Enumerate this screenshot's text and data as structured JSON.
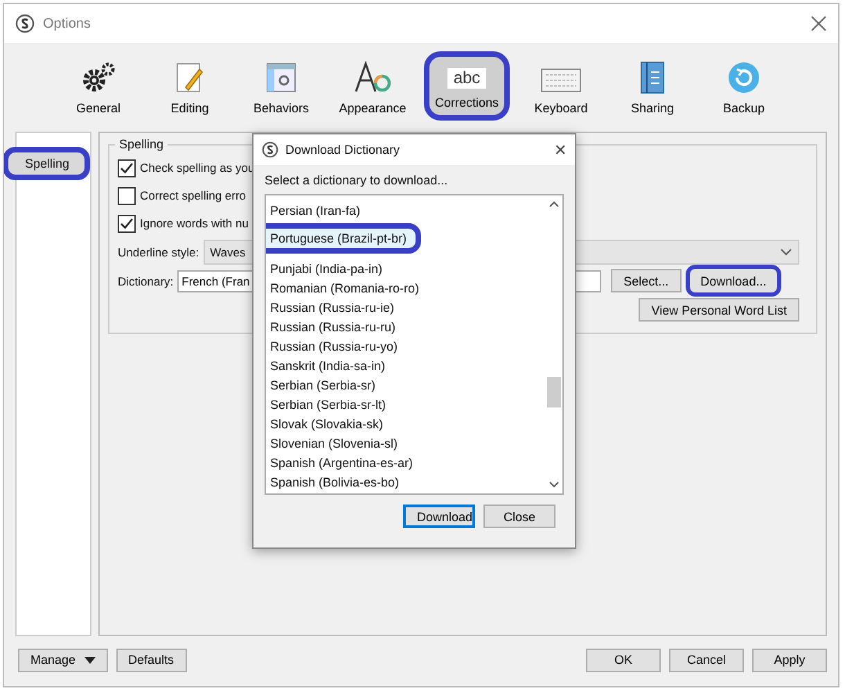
{
  "window": {
    "title": "Options"
  },
  "toolbar": [
    {
      "label": "General",
      "selected": false,
      "highlighted": false
    },
    {
      "label": "Editing",
      "selected": false,
      "highlighted": false
    },
    {
      "label": "Behaviors",
      "selected": false,
      "highlighted": false
    },
    {
      "label": "Appearance",
      "selected": false,
      "highlighted": false
    },
    {
      "label": "Corrections",
      "icon_text": "abc",
      "selected": true,
      "highlighted": true
    },
    {
      "label": "Keyboard",
      "selected": false,
      "highlighted": false
    },
    {
      "label": "Sharing",
      "selected": false,
      "highlighted": false
    },
    {
      "label": "Backup",
      "selected": false,
      "highlighted": false
    }
  ],
  "sidebar": {
    "items": [
      {
        "label": "Spelling",
        "selected": true,
        "highlighted": true
      }
    ]
  },
  "spelling": {
    "title": "Spelling",
    "checkboxes": [
      {
        "label": "Check spelling as you",
        "checked": true
      },
      {
        "label": "Correct spelling erro",
        "checked": false
      },
      {
        "label": "Ignore words with nu",
        "checked": true
      }
    ],
    "underline_label": "Underline style:",
    "underline_value": "Waves",
    "dictionary_label": "Dictionary:",
    "dictionary_value": "French (Fran",
    "buttons": [
      {
        "label": "Select...",
        "highlighted": false
      },
      {
        "label": "Download...",
        "highlighted": true
      }
    ],
    "word_list_button": "View Personal Word List"
  },
  "dialog": {
    "title": "Download Dictionary",
    "close": "✕",
    "prompt": "Select a dictionary to download...",
    "items": [
      {
        "label": "Persian (Iran-fa)",
        "selected": false,
        "highlighted": false
      },
      {
        "label": "Portuguese (Brazil-pt-br)",
        "selected": true,
        "highlighted": true
      },
      {
        "label": "Punjabi (India-pa-in)",
        "selected": false,
        "highlighted": false
      },
      {
        "label": "Romanian (Romania-ro-ro)",
        "selected": false,
        "highlighted": false
      },
      {
        "label": "Russian (Russia-ru-ie)",
        "selected": false,
        "highlighted": false
      },
      {
        "label": "Russian (Russia-ru-ru)",
        "selected": false,
        "highlighted": false
      },
      {
        "label": "Russian (Russia-ru-yo)",
        "selected": false,
        "highlighted": false
      },
      {
        "label": "Sanskrit (India-sa-in)",
        "selected": false,
        "highlighted": false
      },
      {
        "label": "Serbian (Serbia-sr)",
        "selected": false,
        "highlighted": false
      },
      {
        "label": "Serbian (Serbia-sr-lt)",
        "selected": false,
        "highlighted": false
      },
      {
        "label": "Slovak (Slovakia-sk)",
        "selected": false,
        "highlighted": false
      },
      {
        "label": "Slovenian (Slovenia-sl)",
        "selected": false,
        "highlighted": false
      },
      {
        "label": "Spanish (Argentina-es-ar)",
        "selected": false,
        "highlighted": false
      },
      {
        "label": "Spanish (Bolivia-es-bo)",
        "selected": false,
        "highlighted": false
      }
    ],
    "buttons": [
      {
        "label": "Download",
        "default": true
      },
      {
        "label": "Close",
        "default": false
      }
    ]
  },
  "footer": {
    "manage": "Manage",
    "defaults": "Defaults",
    "buttons": [
      "OK",
      "Cancel",
      "Apply"
    ]
  }
}
